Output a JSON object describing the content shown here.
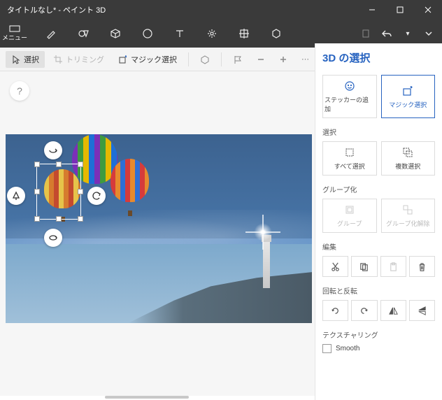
{
  "titlebar": {
    "title": "タイトルなし* - ペイント 3D"
  },
  "ribbon": {
    "menu_label": "メニュー"
  },
  "subtoolbar": {
    "select_label": "選択",
    "trimming_label": "トリミング",
    "magic_select_label": "マジック選択"
  },
  "help": {
    "label": "?"
  },
  "side": {
    "title": "3D の選択",
    "sticker_add": "ステッカーの追加",
    "magic_select": "マジック選択",
    "section_select": "選択",
    "select_all": "すべて選択",
    "multi_select": "複数選択",
    "section_group": "グループ化",
    "group": "グループ",
    "ungroup": "グループ化解除",
    "section_edit": "編集",
    "section_rotate": "回転と反転",
    "section_texture": "テクスチャリング",
    "smooth": "Smooth"
  }
}
